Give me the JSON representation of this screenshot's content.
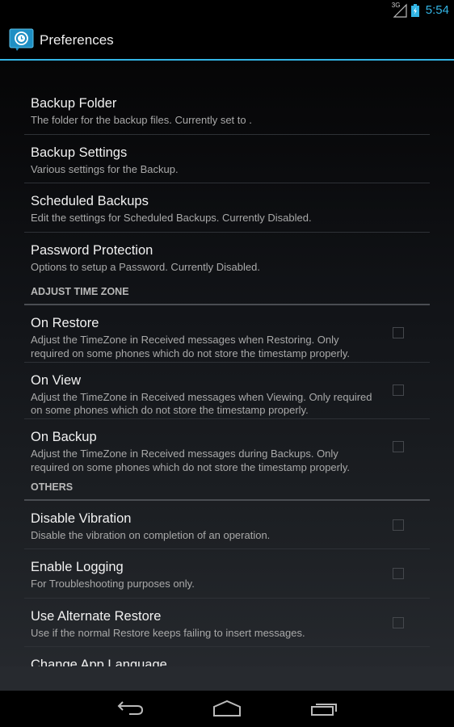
{
  "status_bar": {
    "network_label": "3G",
    "time": "5:54",
    "icons": [
      "signal-icon",
      "battery-charging-icon"
    ]
  },
  "action_bar": {
    "app_icon": "app-backup-clock-icon",
    "title": "Preferences",
    "accent_color": "#33b5e5"
  },
  "preferences": {
    "general": [
      {
        "title": "Backup Folder",
        "summary": "The folder for the backup files. Currently set to ."
      },
      {
        "title": "Backup Settings",
        "summary": "Various settings for the Backup."
      },
      {
        "title": "Scheduled Backups",
        "summary": "Edit the settings for Scheduled Backups. Currently Disabled."
      },
      {
        "title": "Password Protection",
        "summary": "Options to setup a Password. Currently Disabled."
      }
    ],
    "adjust_time_zone": {
      "header": "ADJUST TIME ZONE",
      "items": [
        {
          "title": "On Restore",
          "summary": "Adjust the TimeZone in Received messages when Restoring. Only required on some phones which do not store the timestamp properly.",
          "checked": false
        },
        {
          "title": "On View",
          "summary": "Adjust the TimeZone in Received messages when Viewing. Only required on some phones which do not store the timestamp properly.",
          "checked": false
        },
        {
          "title": "On Backup",
          "summary": "Adjust the TimeZone in Received messages during Backups. Only required on some phones which do not store the timestamp properly.",
          "checked": false
        }
      ]
    },
    "others": {
      "header": "OTHERS",
      "items": [
        {
          "title": "Disable Vibration",
          "summary": "Disable the vibration on completion of an operation.",
          "checked": false
        },
        {
          "title": "Enable Logging",
          "summary": "For Troubleshooting purposes only.",
          "checked": false
        },
        {
          "title": "Use Alternate Restore",
          "summary": "Use if the normal Restore keeps failing to insert messages.",
          "checked": false
        },
        {
          "title": "Change App Language"
        }
      ]
    }
  },
  "nav_bar": {
    "buttons": [
      "back-icon",
      "home-icon",
      "recent-apps-icon"
    ]
  }
}
